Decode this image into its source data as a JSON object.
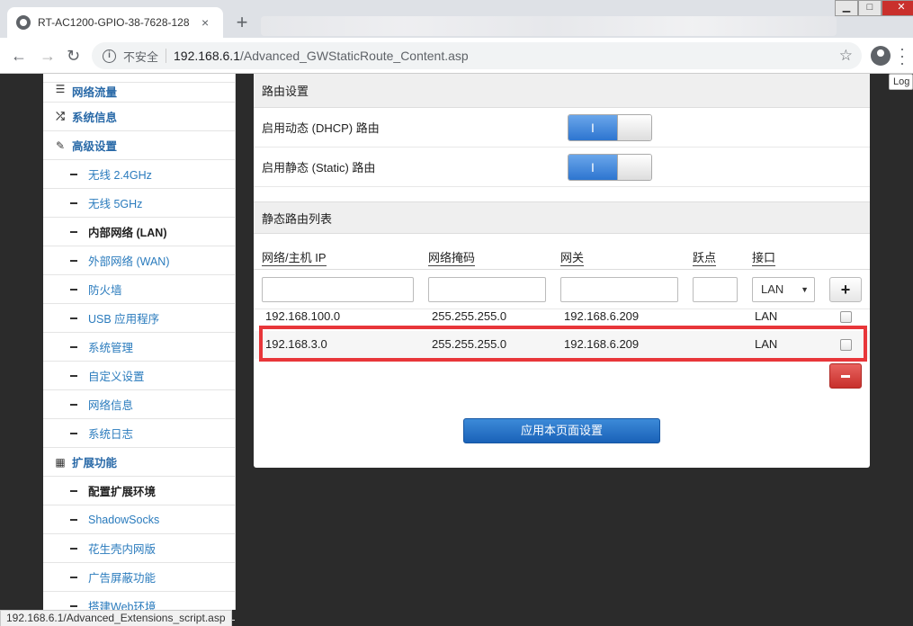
{
  "browser": {
    "tab_title": "RT-AC1200-GPIO-38-7628-128",
    "tab_close": "×",
    "new_tab": "+",
    "security_label": "不安全",
    "url_host": "192.168.6.1",
    "url_path": "/Advanced_GWStaticRoute_Content.asp",
    "status_url": "192.168.6.1/Advanced_Extensions_script.asp"
  },
  "window_controls": {
    "minimize": "▁",
    "maximize": "□",
    "close": "✕"
  },
  "sidebar": {
    "items": [
      {
        "label": "网络流量",
        "type": "group",
        "icon": "list-icon"
      },
      {
        "label": "系统信息",
        "type": "group",
        "icon": "shuffle-icon"
      },
      {
        "label": "高级设置",
        "type": "group",
        "icon": "wrench-icon"
      },
      {
        "label": "无线 2.4GHz",
        "type": "sub"
      },
      {
        "label": "无线 5GHz",
        "type": "sub"
      },
      {
        "label": "内部网络 (LAN)",
        "type": "sub",
        "active": true
      },
      {
        "label": "外部网络 (WAN)",
        "type": "sub"
      },
      {
        "label": "防火墙",
        "type": "sub"
      },
      {
        "label": "USB 应用程序",
        "type": "sub"
      },
      {
        "label": "系统管理",
        "type": "sub"
      },
      {
        "label": "自定义设置",
        "type": "sub"
      },
      {
        "label": "网络信息",
        "type": "sub"
      },
      {
        "label": "系统日志",
        "type": "sub"
      },
      {
        "label": "扩展功能",
        "type": "group",
        "icon": "grid-icon"
      },
      {
        "label": "配置扩展环境",
        "type": "sub",
        "active": true
      },
      {
        "label": "ShadowSocks",
        "type": "sub"
      },
      {
        "label": "花生壳内网版",
        "type": "sub"
      },
      {
        "label": "广告屏蔽功能",
        "type": "sub"
      },
      {
        "label": "搭建Web环境",
        "type": "sub"
      }
    ]
  },
  "panel": {
    "routing_header": "路由设置",
    "dhcp_route_label": "启用动态 (DHCP) 路由",
    "static_route_label": "启用静态 (Static) 路由",
    "toggle_on_label": "I",
    "static_list_header": "静态路由列表",
    "columns": [
      "网络/主机 IP",
      "网络掩码",
      "网关",
      "跃点",
      "接口"
    ],
    "interface_select_value": "LAN",
    "add_button": "+",
    "routes": [
      {
        "ip": "192.168.100.0",
        "mask": "255.255.255.0",
        "gateway": "192.168.6.209",
        "metric": "",
        "iface": "LAN"
      },
      {
        "ip": "192.168.3.0",
        "mask": "255.255.255.0",
        "gateway": "192.168.6.209",
        "metric": "",
        "iface": "LAN"
      }
    ],
    "apply_button": "应用本页面设置"
  },
  "log_tab": "Log",
  "colors": {
    "highlight": "#e8363a",
    "link": "#2a7bbd",
    "apply": "#1a62b8",
    "delete": "#c7302c"
  }
}
